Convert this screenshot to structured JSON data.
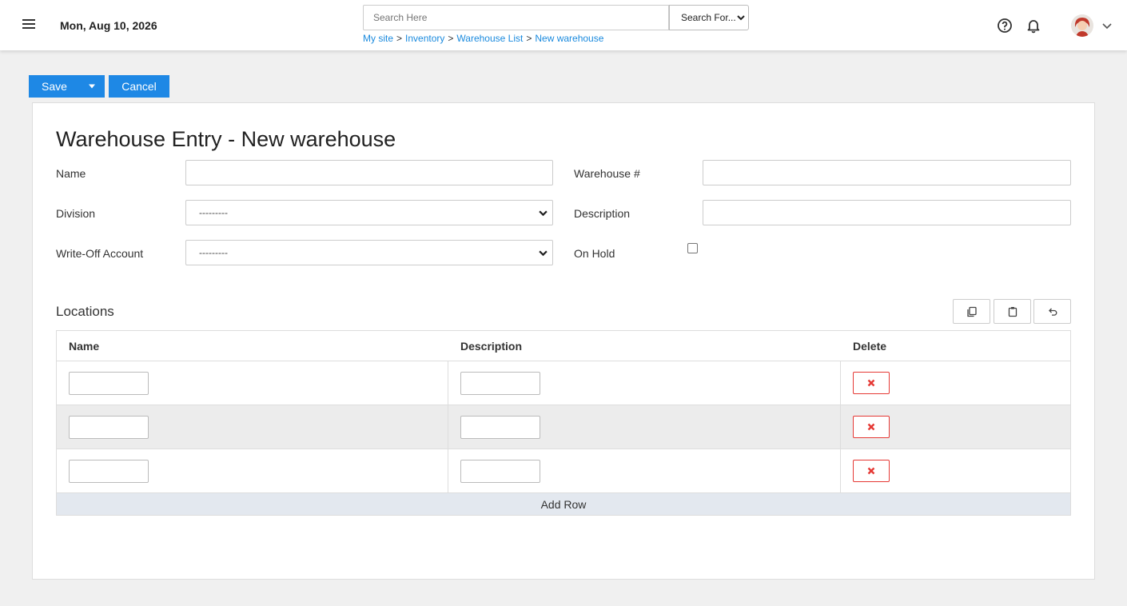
{
  "header": {
    "date": "Mon, Aug 10, 2026",
    "search_placeholder": "Search Here",
    "search_scope": "Search For...",
    "breadcrumb": [
      {
        "label": "My site"
      },
      {
        "label": "Inventory"
      },
      {
        "label": "Warehouse List"
      },
      {
        "label": "New warehouse"
      }
    ],
    "breadcrumb_separator": ">",
    "icons": [
      "menu-icon",
      "help-icon",
      "bell-icon",
      "avatar",
      "chevron-down-icon"
    ]
  },
  "toolbar": {
    "save_label": "Save",
    "cancel_label": "Cancel"
  },
  "form": {
    "title": "Warehouse Entry - New warehouse",
    "fields": {
      "name_label": "Name",
      "name_value": "",
      "warehouse_no_label": "Warehouse #",
      "warehouse_no_value": "",
      "division_label": "Division",
      "division_selected": "---------",
      "description_label": "Description",
      "description_value": "",
      "writeoff_label": "Write-Off Account",
      "writeoff_selected": "---------",
      "onhold_label": "On Hold",
      "onhold_checked": false
    }
  },
  "locations": {
    "title": "Locations",
    "tools": [
      "copy-icon",
      "paste-icon",
      "undo-icon"
    ],
    "columns": [
      "Name",
      "Description",
      "Delete"
    ],
    "rows": [
      {
        "name": "",
        "description": ""
      },
      {
        "name": "",
        "description": ""
      },
      {
        "name": "",
        "description": ""
      }
    ],
    "add_row_label": "Add Row"
  },
  "colors": {
    "primary": "#1e88e5",
    "link": "#1a8ade",
    "delete": "#e53935",
    "add_row_bg": "#e3e8ef"
  }
}
